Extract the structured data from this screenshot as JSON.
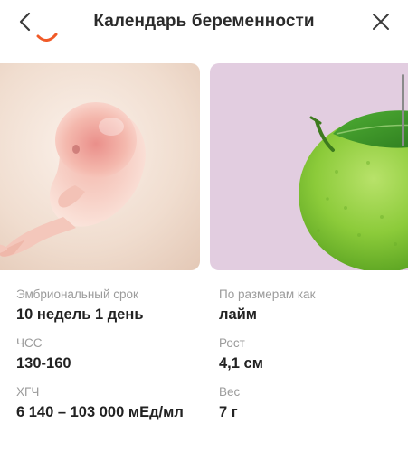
{
  "header": {
    "title": "Календарь беременности"
  },
  "icons": {
    "back": "chevron-left-icon",
    "close": "close-icon"
  },
  "colors": {
    "accent": "#f05a28",
    "label": "#9b9b9b",
    "value": "#222222",
    "fruit_bg": "#e2cde0",
    "embryo_bg": "#f1dfd2"
  },
  "cards": [
    {
      "name": "embryo-image",
      "subject": "embryo"
    },
    {
      "name": "size-comparison-image",
      "subject": "lime"
    }
  ],
  "stats": {
    "left": [
      {
        "label": "Эмбриональный срок",
        "value": "10 недель 1 день"
      },
      {
        "label": "ЧСС",
        "value": "130-160"
      },
      {
        "label": "ХГЧ",
        "value": "6 140 – 103 000 мЕд/мл"
      }
    ],
    "right": [
      {
        "label": "По размерам как",
        "value": "лайм"
      },
      {
        "label": "Рост",
        "value": "4,1 см"
      },
      {
        "label": "Вес",
        "value": "7 г"
      }
    ]
  }
}
